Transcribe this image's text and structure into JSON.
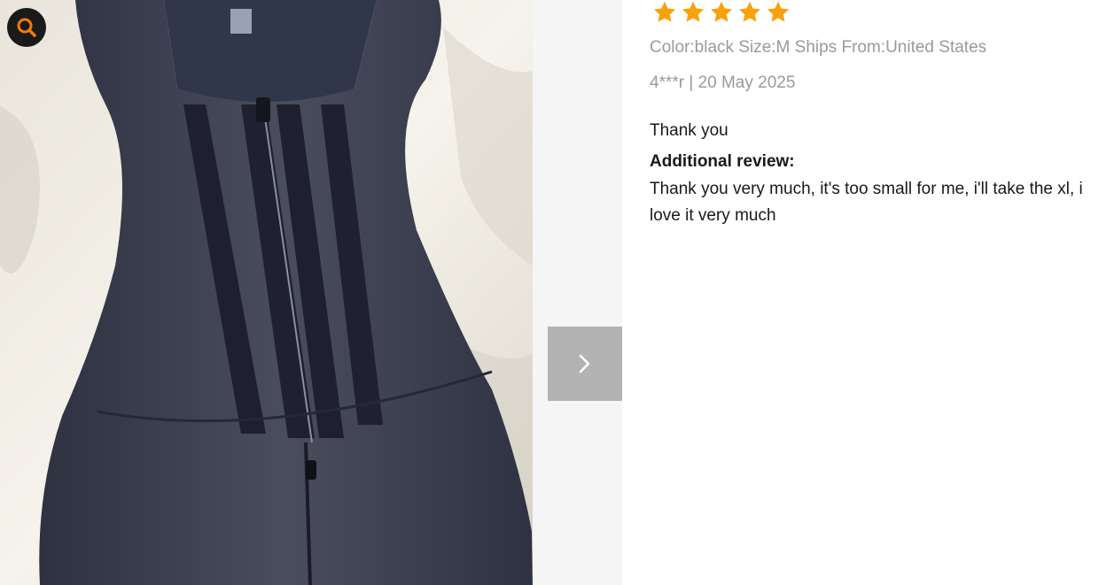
{
  "review": {
    "rating": 5,
    "max_rating": 5,
    "star_color": "#f7a10e",
    "sku_info": "Color:black Size:M Ships From:United States",
    "author_date": "4***r | 20 May 2025",
    "text": "Thank you",
    "additional_heading": "Additional review:",
    "additional_text": "Thank you very much, it's too small for me, i'll take the xl, i love it very much"
  },
  "gallery": {
    "zoom_icon": "search-icon",
    "zoom_icon_color": "#f57c00",
    "next_icon": "chevron-right-icon"
  }
}
